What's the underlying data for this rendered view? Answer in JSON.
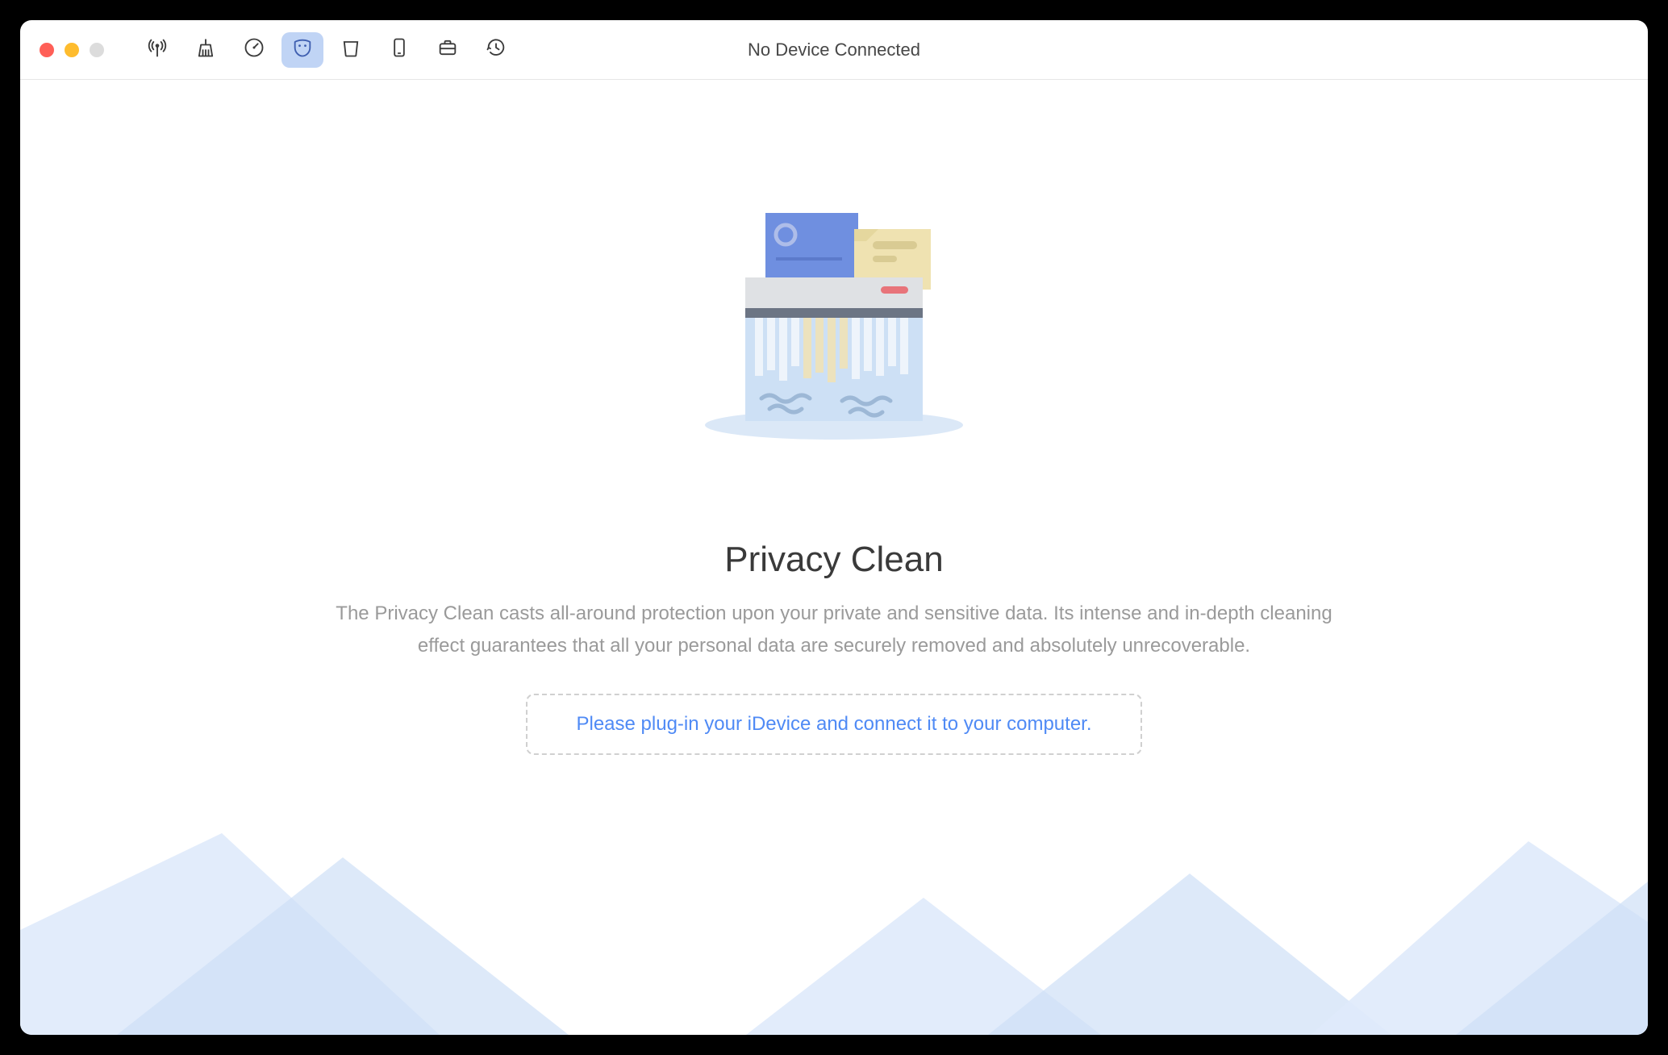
{
  "window": {
    "title": "No Device Connected"
  },
  "toolbar": {
    "items": [
      {
        "name": "broadcast-icon"
      },
      {
        "name": "brush-icon"
      },
      {
        "name": "speed-icon"
      },
      {
        "name": "mask-icon",
        "active": true
      },
      {
        "name": "trash-icon"
      },
      {
        "name": "phone-icon"
      },
      {
        "name": "briefcase-icon"
      },
      {
        "name": "history-icon"
      }
    ]
  },
  "page": {
    "title": "Privacy Clean",
    "description": "The Privacy Clean casts all-around protection upon your private and sensitive data. Its intense and in-depth cleaning effect guarantees that all your personal data are securely removed and absolutely unrecoverable.",
    "prompt": "Please plug-in your iDevice and connect it to your computer."
  }
}
